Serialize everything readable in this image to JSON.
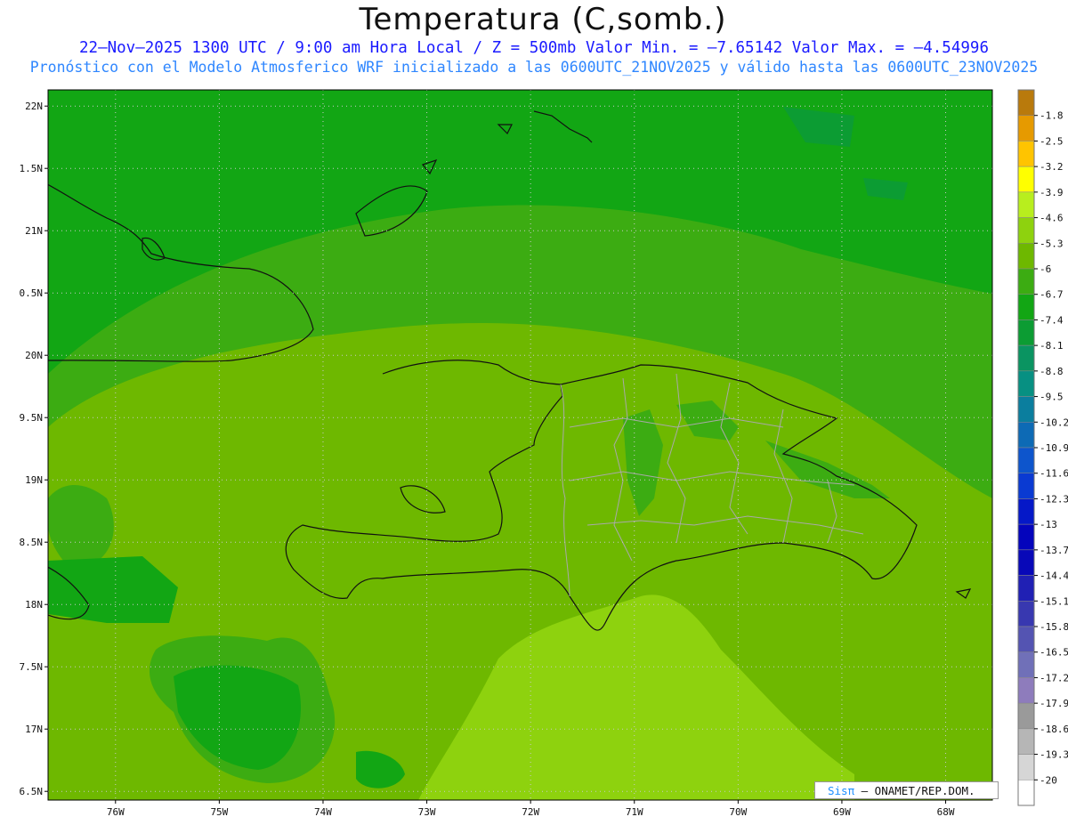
{
  "header": {
    "title": "Temperatura (C,somb.)",
    "line1": "22–Nov–2025  1300 UTC / 9:00 am Hora Local / Z = 500mb  Valor Min. = –7.65142  Valor Max. = –4.54996",
    "line2": "Pronóstico con el Modelo Atmosferico WRF inicializado a las 0600UTC_21NOV2025 y válido hasta las  0600UTC_23NOV2025"
  },
  "map_data": {
    "variable": "Temperatura",
    "units": "C",
    "level": "500mb",
    "value_min": -7.65142,
    "value_max": -4.54996,
    "lon_range": [
      -76.65,
      -67.55
    ],
    "lat_range": [
      16.43,
      22.13
    ],
    "lat_ticks": [
      "22N",
      "1.5N",
      "21N",
      "0.5N",
      "20N",
      "9.5N",
      "19N",
      "8.5N",
      "18N",
      "7.5N",
      "17N",
      "6.5N"
    ],
    "lon_ticks": [
      "76W",
      "75W",
      "74W",
      "73W",
      "72W",
      "71W",
      "70W",
      "69W",
      "68W"
    ],
    "grid": "dotted"
  },
  "legend": {
    "levels": [
      "-1.8",
      "-2.5",
      "-3.2",
      "-3.9",
      "-4.6",
      "-5.3",
      "-6",
      "-6.7",
      "-7.4",
      "-8.1",
      "-8.8",
      "-9.5",
      "-10.2",
      "-10.9",
      "-11.6",
      "-12.3",
      "-13",
      "-13.7",
      "-14.4",
      "-15.1",
      "-15.8",
      "-16.5",
      "-17.2",
      "-17.9",
      "-18.6",
      "-19.3",
      "-20"
    ],
    "colors": [
      "#b97a0c",
      "#e69a00",
      "#ffc400",
      "#ffff00",
      "#b8ee1e",
      "#8ed20e",
      "#6eb800",
      "#3cac12",
      "#12a614",
      "#0c9c33",
      "#0a9461",
      "#079082",
      "#0b7e9e",
      "#0d6ab5",
      "#0d55cc",
      "#0a3ad2",
      "#0518c8",
      "#0404bc",
      "#0808b8",
      "#2020b4",
      "#3838b0",
      "#5454b2",
      "#7070b8",
      "#8e7cbc",
      "#9a9a9a",
      "#b6b6b6",
      "#d6d6d6",
      "#ffffff"
    ]
  },
  "credit": {
    "brand": "Sisπ",
    "text": " – ONAMET/REP.DOM."
  },
  "colors": {
    "sea": "#12a614",
    "land": "#6eb800",
    "warm": "#8ed20e",
    "coast": "#111111",
    "borders": "#a9a9a9"
  }
}
